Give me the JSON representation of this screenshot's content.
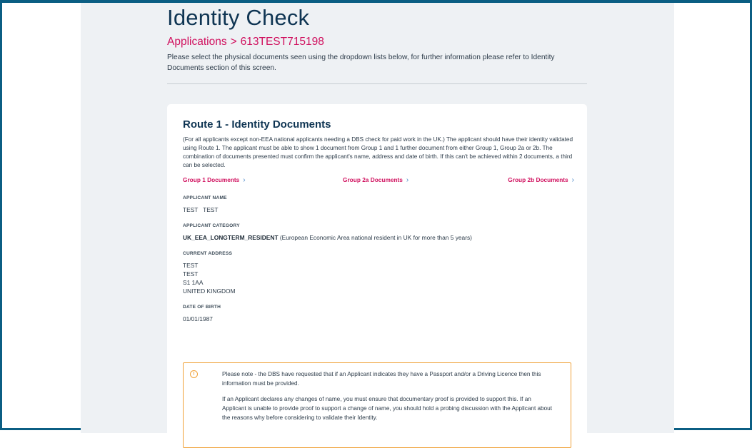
{
  "header": {
    "title": "Identity Check",
    "breadcrumb": {
      "parent": "Applications",
      "separator": ">",
      "current": "613TEST715198"
    },
    "intro": "Please select the physical documents seen using the dropdown lists below, for further information please refer to Identity Documents section of this screen."
  },
  "route": {
    "title": "Route 1 - Identity Documents",
    "description": "(For all applicants except non-EEA national applicants needing a DBS check for paid work in the UK.) The applicant should have their identity validated using Route 1. The applicant must be able to show 1 document from Group 1 and 1 further document from either Group 1, Group 2a or 2b. The combination of documents presented must confirm the applicant's name, address and date of birth. If this can't be achieved within 2 documents, a third can be selected.",
    "group_links": [
      {
        "label": "Group 1 Documents",
        "icon": "chevron-right-icon"
      },
      {
        "label": "Group 2a Documents",
        "icon": "chevron-right-icon"
      },
      {
        "label": "Group 2b Documents",
        "icon": "chevron-right-icon"
      }
    ]
  },
  "applicant": {
    "name_label": "APPLICANT NAME",
    "name_value": "TEST   TEST",
    "category_label": "APPLICANT CATEGORY",
    "category_code": "UK_EEA_LONGTERM_RESIDENT",
    "category_desc": " (European Economic Area national resident in UK for more than 5 years)",
    "address_label": "CURRENT ADDRESS",
    "address_lines": [
      "TEST",
      "TEST",
      "S1 1AA",
      "UNITED KINGDOM"
    ],
    "dob_label": "DATE OF BIRTH",
    "dob_value": "01/01/1987"
  },
  "notice": {
    "icon": "info-icon",
    "paragraphs": [
      "Please note - the DBS have requested that if an Applicant indicates they have a Passport and/or a Driving Licence then this information must be provided.",
      "If an Applicant declares any changes of name, you must ensure that documentary proof is provided to support this. If an Applicant is unable to provide proof to support a change of name, you should hold a probing discussion with the Applicant about the reasons why before considering to validate their Identity."
    ]
  },
  "colors": {
    "title": "#0f3553",
    "accent": "#d0105e",
    "chevron": "#4a88c8",
    "notice_border": "#f0a23a",
    "frame": "#0b5e83",
    "panel_bg": "#eef1f4"
  }
}
